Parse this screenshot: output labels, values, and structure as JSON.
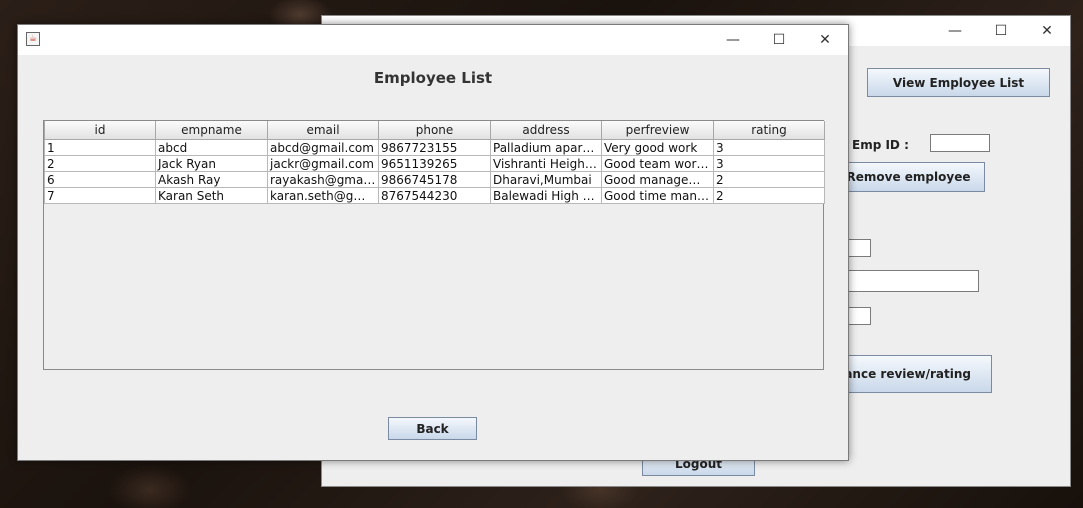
{
  "background_window": {
    "controls": {
      "minimize": "—",
      "maximize": "☐",
      "close": "✕"
    },
    "view_employee_button": "View Employee List",
    "emp_id_label": "Emp ID :",
    "emp_id_value": "",
    "remove_button": "Remove employee",
    "performance_button": "Performance review/rating",
    "logout_button": "Logout"
  },
  "employee_window": {
    "icon": "java-icon",
    "controls": {
      "minimize": "—",
      "maximize": "☐",
      "close": "✕"
    },
    "title": "Employee List",
    "back_button": "Back"
  },
  "table": {
    "columns": [
      "id",
      "empname",
      "email",
      "phone",
      "address",
      "perfreview",
      "rating"
    ],
    "rows": [
      [
        "1",
        "abcd",
        "abcd@gmail.com",
        "9867723155",
        "Palladium apartm...",
        "Very good work",
        "3"
      ],
      [
        "2",
        "Jack Ryan",
        "jackr@gmail.com",
        "9651139265",
        "Vishranti Heights,...",
        "Good team worker",
        "3"
      ],
      [
        "6",
        "Akash Ray",
        "rayakash@gmail....",
        "9866745178",
        "Dharavi,Mumbai",
        "Good management",
        "2"
      ],
      [
        "7",
        "Karan Seth",
        "karan.seth@gmai...",
        "8767544230",
        "Balewadi High Str...",
        "Good time manag...",
        "2"
      ]
    ]
  }
}
